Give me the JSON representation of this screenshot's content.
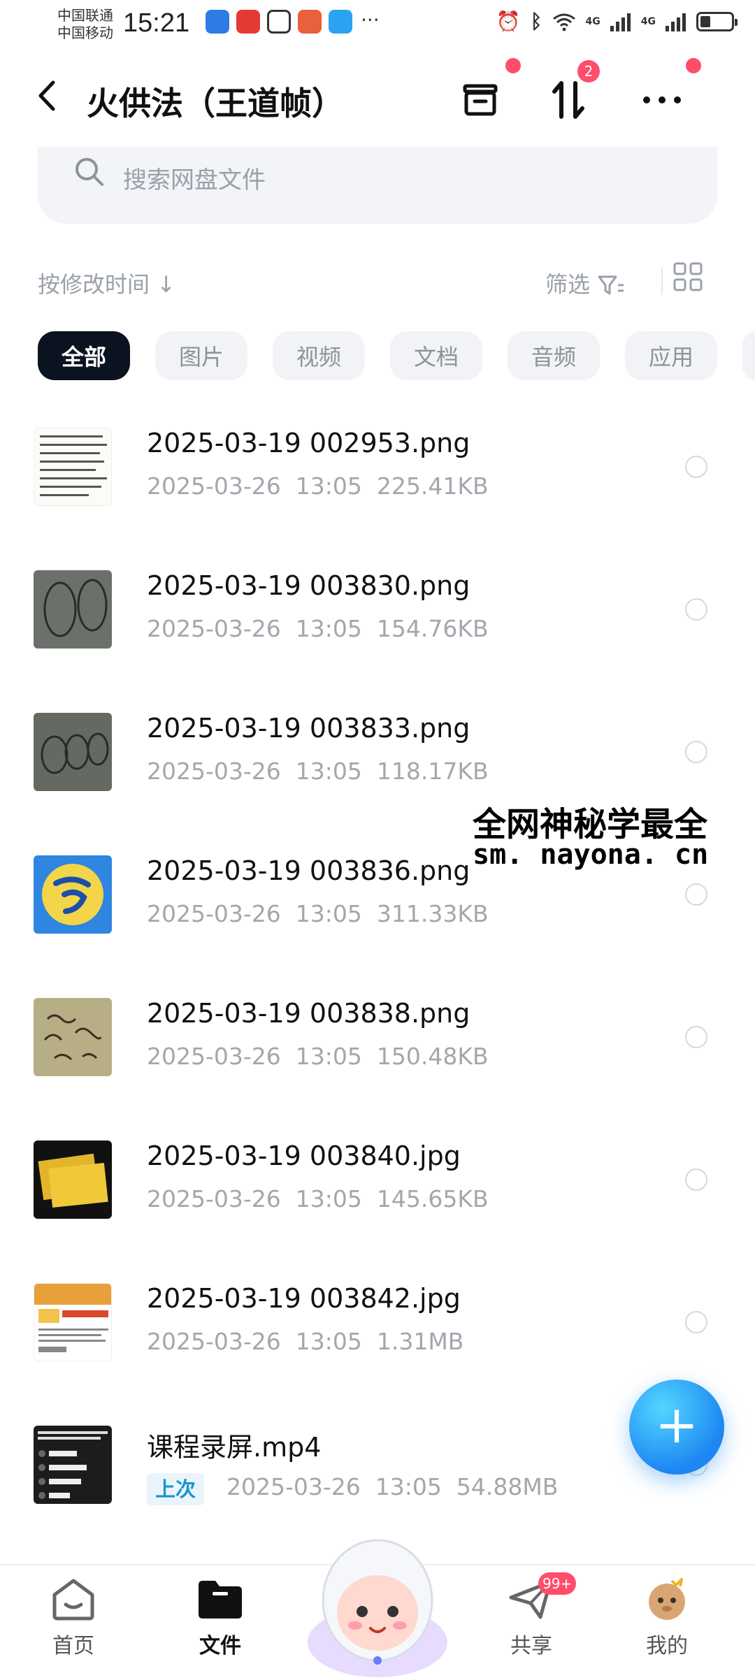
{
  "status_bar": {
    "carrier_1": "中国联通",
    "carrier_2": "中国移动",
    "time": "15:21",
    "signal_1": "4G",
    "signal_2": "4G"
  },
  "header": {
    "back_icon": "chevron-left-icon",
    "title": "火供法（王道帧）",
    "transfer_badge": "2"
  },
  "search": {
    "placeholder": "搜索网盘文件"
  },
  "sort": {
    "label": "按修改时间",
    "filter_label": "筛选"
  },
  "tabs": [
    {
      "label": "全部",
      "active": true
    },
    {
      "label": "图片"
    },
    {
      "label": "视频"
    },
    {
      "label": "文档"
    },
    {
      "label": "音频"
    },
    {
      "label": "应用"
    }
  ],
  "files": [
    {
      "name": "2025-03-19 002953.png",
      "date": "2025-03-26",
      "time": "13:05",
      "size": "225.41KB"
    },
    {
      "name": "2025-03-19 003830.png",
      "date": "2025-03-26",
      "time": "13:05",
      "size": "154.76KB"
    },
    {
      "name": "2025-03-19 003833.png",
      "date": "2025-03-26",
      "time": "13:05",
      "size": "118.17KB"
    },
    {
      "name": "2025-03-19 003836.png",
      "date": "2025-03-26",
      "time": "13:05",
      "size": "311.33KB"
    },
    {
      "name": "2025-03-19 003838.png",
      "date": "2025-03-26",
      "time": "13:05",
      "size": "150.48KB"
    },
    {
      "name": "2025-03-19 003840.jpg",
      "date": "2025-03-26",
      "time": "13:05",
      "size": "145.65KB"
    },
    {
      "name": "2025-03-19 003842.jpg",
      "date": "2025-03-26",
      "time": "13:05",
      "size": "1.31MB"
    },
    {
      "name": "课程录屏.mp4",
      "tag": "上次",
      "date": "2025-03-26",
      "time": "13:05",
      "size": "54.88MB"
    }
  ],
  "watermark": {
    "line1": "全网神秘学最全",
    "line2": "sm. nayona. cn"
  },
  "fab": {
    "label": "+"
  },
  "bottom_nav": [
    {
      "label": "首页"
    },
    {
      "label": "文件",
      "active": true
    },
    {
      "label": "共享",
      "badge": "99+"
    },
    {
      "label": "我的"
    }
  ],
  "colors": {
    "accent": "#1d86f2",
    "badge": "#ff4d6a",
    "chip_active": "#0b1220"
  }
}
